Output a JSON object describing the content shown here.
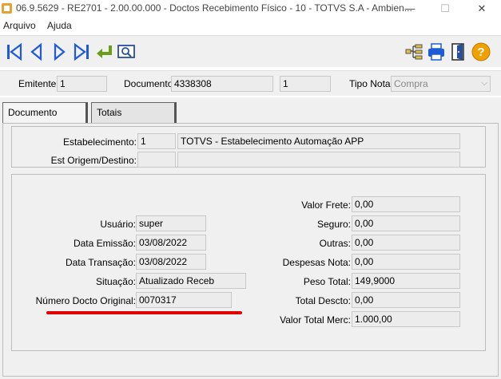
{
  "window": {
    "title": "06.9.5629 - RE2701 - 2.00.00.000 - Doctos Recebimento Físico - 10 - TOTVS S.A - Ambien...",
    "minimize_glyph": "—",
    "maximize_glyph": "☐",
    "close_glyph": "✕"
  },
  "menu": {
    "items": [
      "Arquivo",
      "Ajuda"
    ]
  },
  "toolbar": {
    "icons": [
      "first-record-icon",
      "previous-record-icon",
      "next-record-icon",
      "last-record-icon",
      "go-to-icon",
      "search-icon",
      "tree-icon",
      "print-icon",
      "exit-icon",
      "help-icon"
    ],
    "colors": {
      "nav_blue": "#1f5bd6",
      "goto_green": "#6a9e1a",
      "help_orange": "#f0a000"
    }
  },
  "header": {
    "emitente_label": "Emitente:",
    "emitente_value": "1",
    "documento_label": "Documento:",
    "documento_value": "4338308",
    "serie_value": "1",
    "tipo_nota_label": "Tipo Nota:",
    "tipo_nota_value": "Compra"
  },
  "tabs": [
    {
      "label": "Documento",
      "active": true
    },
    {
      "label": "Totais",
      "active": false
    }
  ],
  "estabelecimento": {
    "label": "Estabelecimento:",
    "code": "1",
    "name": "TOTVS - Estabelecimento Automação APP",
    "origem_label": "Est Origem/Destino:",
    "origem_code": "",
    "origem_name": ""
  },
  "left_fields": [
    {
      "label": "Usuário:",
      "value": "super"
    },
    {
      "label": "Data Emissão:",
      "value": "03/08/2022"
    },
    {
      "label": "Data Transação:",
      "value": "03/08/2022"
    },
    {
      "label": "Situação:",
      "value": "Atualizado Receb"
    },
    {
      "label": "Número Docto Original:",
      "value": "0070317"
    }
  ],
  "right_fields": [
    {
      "label": "Valor Frete:",
      "value": "0,00"
    },
    {
      "label": "Seguro:",
      "value": "0,00"
    },
    {
      "label": "Outras:",
      "value": "0,00"
    },
    {
      "label": "Despesas Nota:",
      "value": "0,00"
    },
    {
      "label": "Peso Total:",
      "value": "149,9000"
    },
    {
      "label": "Total Descto:",
      "value": "0,00"
    },
    {
      "label": "Valor Total Merc:",
      "value": "1.000,00"
    }
  ],
  "highlight_color": "#e00000"
}
